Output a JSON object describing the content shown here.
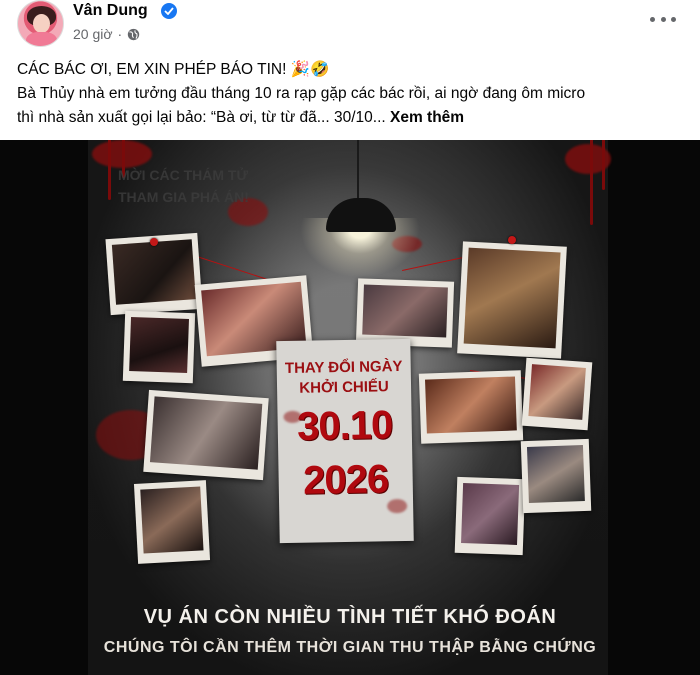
{
  "post": {
    "author": "Vân Dung",
    "time": "20 giờ",
    "text_line1": "CÁC BÁC ƠI, EM XIN PHÉP BÁO TIN! 🎉🤣",
    "text_line2": "Bà Thủy nhà em tưởng đầu tháng 10 ra rạp gặp các bác rồi, ai ngờ đang ôm micro",
    "text_line3": "thì nhà sản xuất gọi lại bảo: “Bà ơi, từ từ đã... 30/10...",
    "see_more": "Xem thêm"
  },
  "poster": {
    "wall_text_1": "MỜI CÁC THÁM TỬ",
    "wall_text_2": "THAM GIA PHÁ ÁN!",
    "card_title_1": "THAY ĐỔI NGÀY",
    "card_title_2": "KHỞI CHIẾU",
    "card_date": "30.10",
    "card_year": "2026",
    "caption_1": "VỤ ÁN CÒN NHIỀU TÌNH TIẾT KHÓ ĐOÁN",
    "caption_2": "CHÚNG TÔI CẦN THÊM THỜI GIAN THU THẬP BẰNG CHỨNG"
  },
  "icons": {
    "verified": "verified-badge-icon",
    "privacy": "globe-icon",
    "menu": "more-options-icon"
  },
  "colors": {
    "verified_blue": "#1877f2",
    "secondary_text": "#65676b",
    "blood_red": "#b0090f"
  }
}
